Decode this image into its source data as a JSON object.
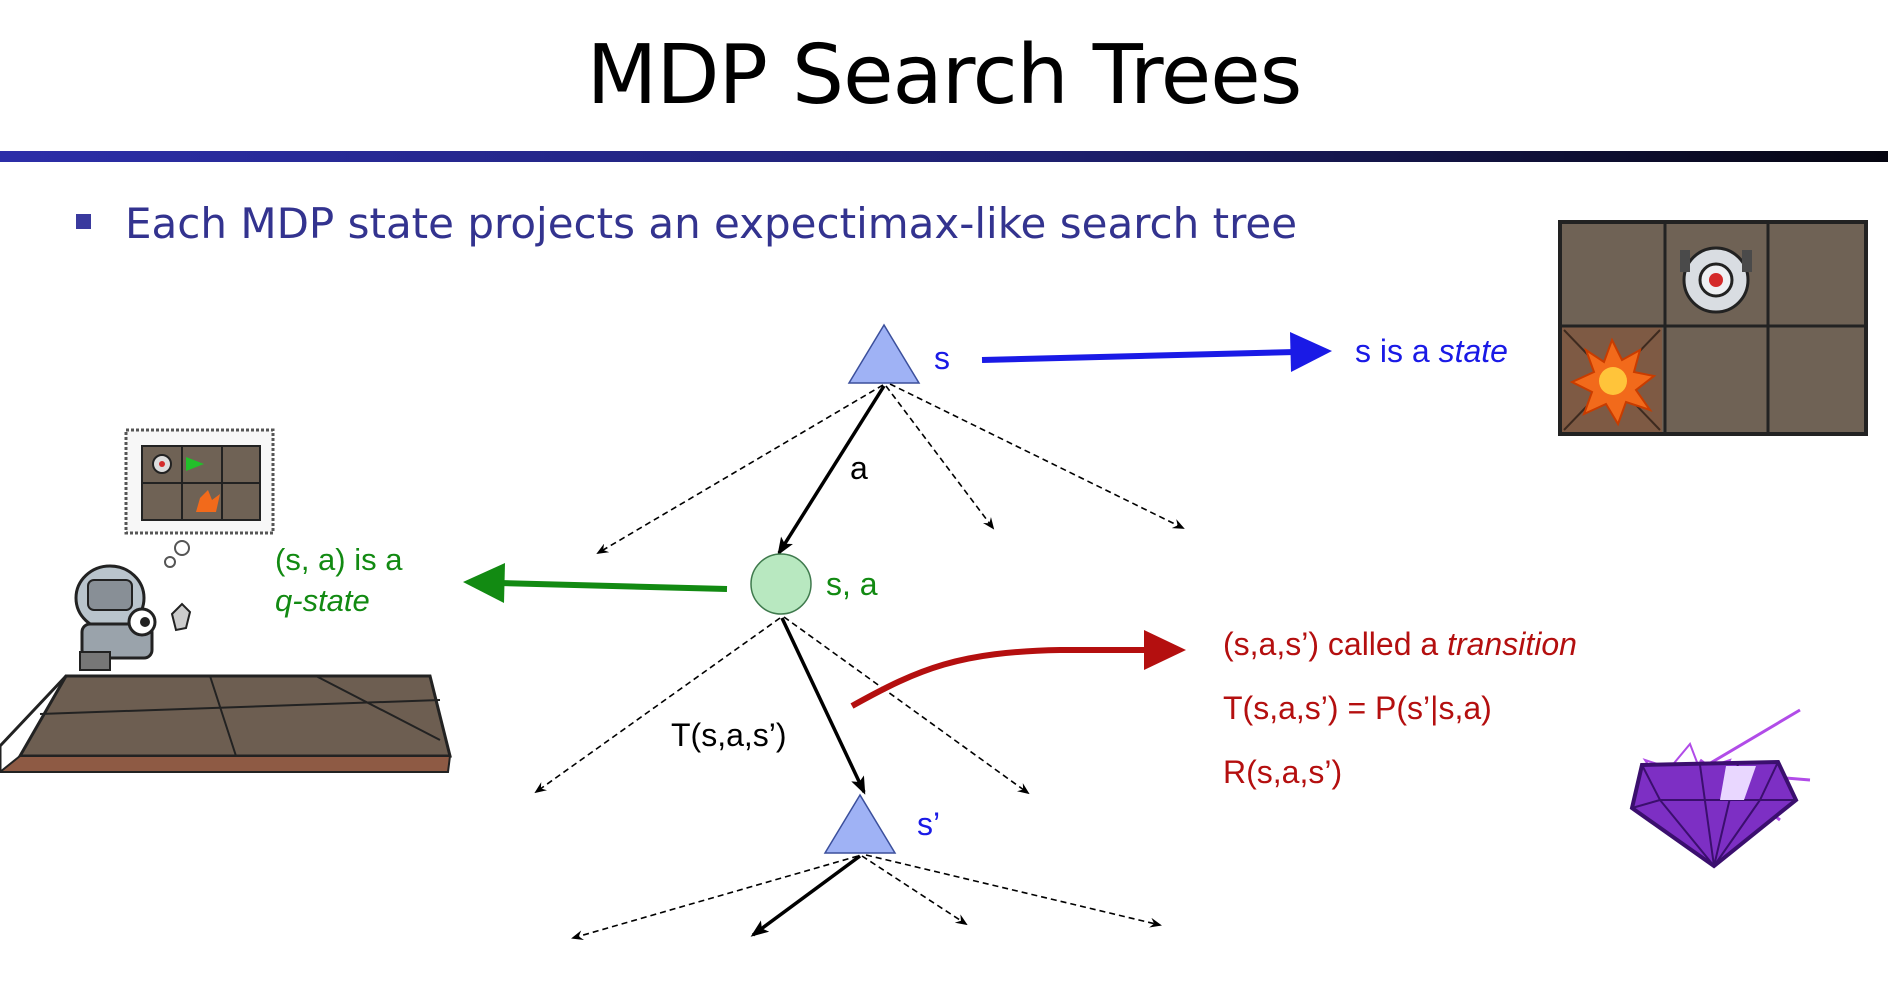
{
  "title": "MDP Search Trees",
  "bullet": "Each MDP state projects an expectimax-like search tree",
  "labels": {
    "s": "s",
    "a": "a",
    "sa": "s, a",
    "T": "T(s,a,s’)",
    "s_prime": "s’"
  },
  "annotations": {
    "state": {
      "prefix": "s is a ",
      "emph": "state"
    },
    "qstate": {
      "line1": "(s, a) is a",
      "line2": "q-state"
    },
    "transition": {
      "prefix": "(s,a,s’) called a ",
      "emph": "transition",
      "line2": "T(s,a,s’) = P(s’|s,a)",
      "line3": "R(s,a,s’)"
    }
  },
  "colors": {
    "title_rule": "#1e2070",
    "bullet_text": "#33338f",
    "state_node": "#9fb2f5",
    "qstate_node": "#b8e8c0",
    "blue_arrow": "#1a1ae6",
    "green_arrow": "#128a12",
    "red_arrow": "#b40f0f",
    "gem": "#8a3fd0"
  },
  "illustrations": [
    "gridworld-state-icon",
    "robot-thinking-icon",
    "gem-reward-icon"
  ]
}
